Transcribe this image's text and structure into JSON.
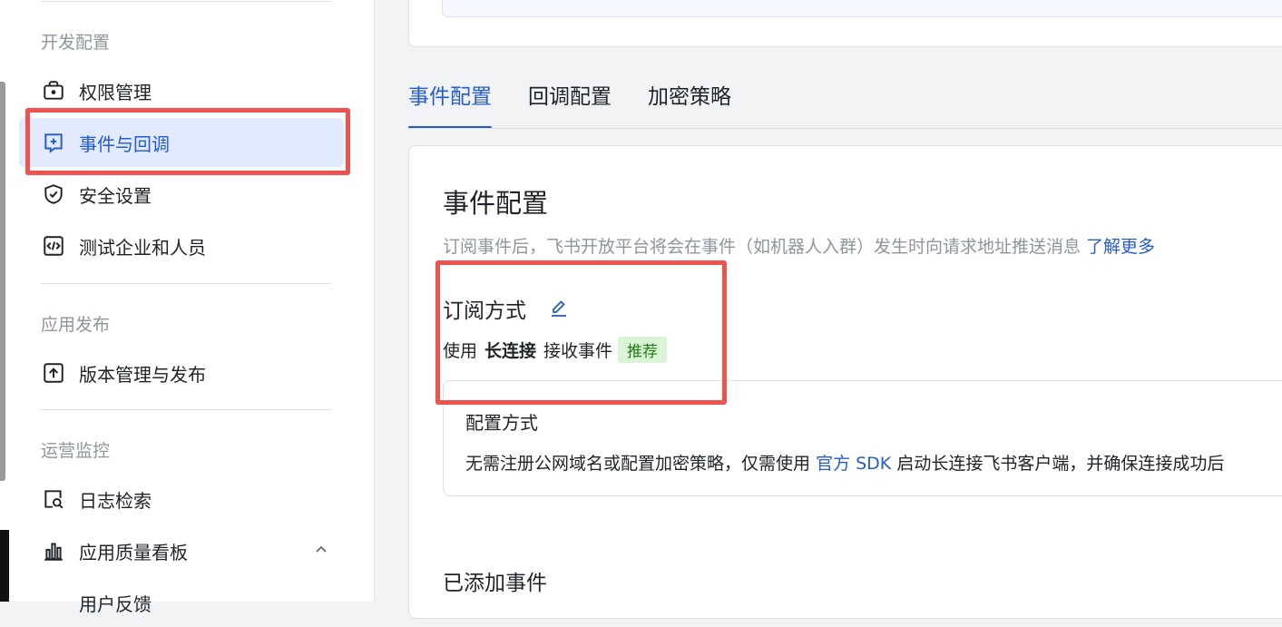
{
  "sidebar": {
    "groups": [
      {
        "title": "开发配置"
      },
      {
        "title": "应用发布"
      },
      {
        "title": "运营监控"
      }
    ],
    "items": [
      {
        "label": "权限管理",
        "icon": "briefcase-icon"
      },
      {
        "label": "事件与回调",
        "icon": "plus-message-icon",
        "active": true
      },
      {
        "label": "安全设置",
        "icon": "shield-check-icon"
      },
      {
        "label": "测试企业和人员",
        "icon": "code-box-icon"
      },
      {
        "label": "版本管理与发布",
        "icon": "upload-box-icon"
      },
      {
        "label": "日志检索",
        "icon": "doc-search-icon"
      },
      {
        "label": "应用质量看板",
        "icon": "bar-chart-icon"
      },
      {
        "label": "用户反馈",
        "icon": ""
      }
    ]
  },
  "tabs": [
    "事件配置",
    "回调配置",
    "加密策略"
  ],
  "main": {
    "title": "事件配置",
    "description": "订阅事件后，飞书开放平台将会在事件（如机器人入群）发生时向请求地址推送消息",
    "learn_more": "了解更多",
    "subscribe_title": "订阅方式",
    "usage_prefix": "使用",
    "usage_bold": "长连接",
    "usage_suffix": "接收事件",
    "badge": "推荐",
    "config_title": "配置方式",
    "config_desc_prefix": "无需注册公网域名或配置加密策略，仅需使用",
    "config_link": "官方 SDK",
    "config_desc_suffix": "启动长连接飞书客户端，并确保连接成功后",
    "added_events_title": "已添加事件"
  },
  "colors": {
    "accent": "#245bdb",
    "highlight": "#ef5350",
    "badge_bg": "#d9f5d6",
    "badge_text": "#237b19"
  }
}
